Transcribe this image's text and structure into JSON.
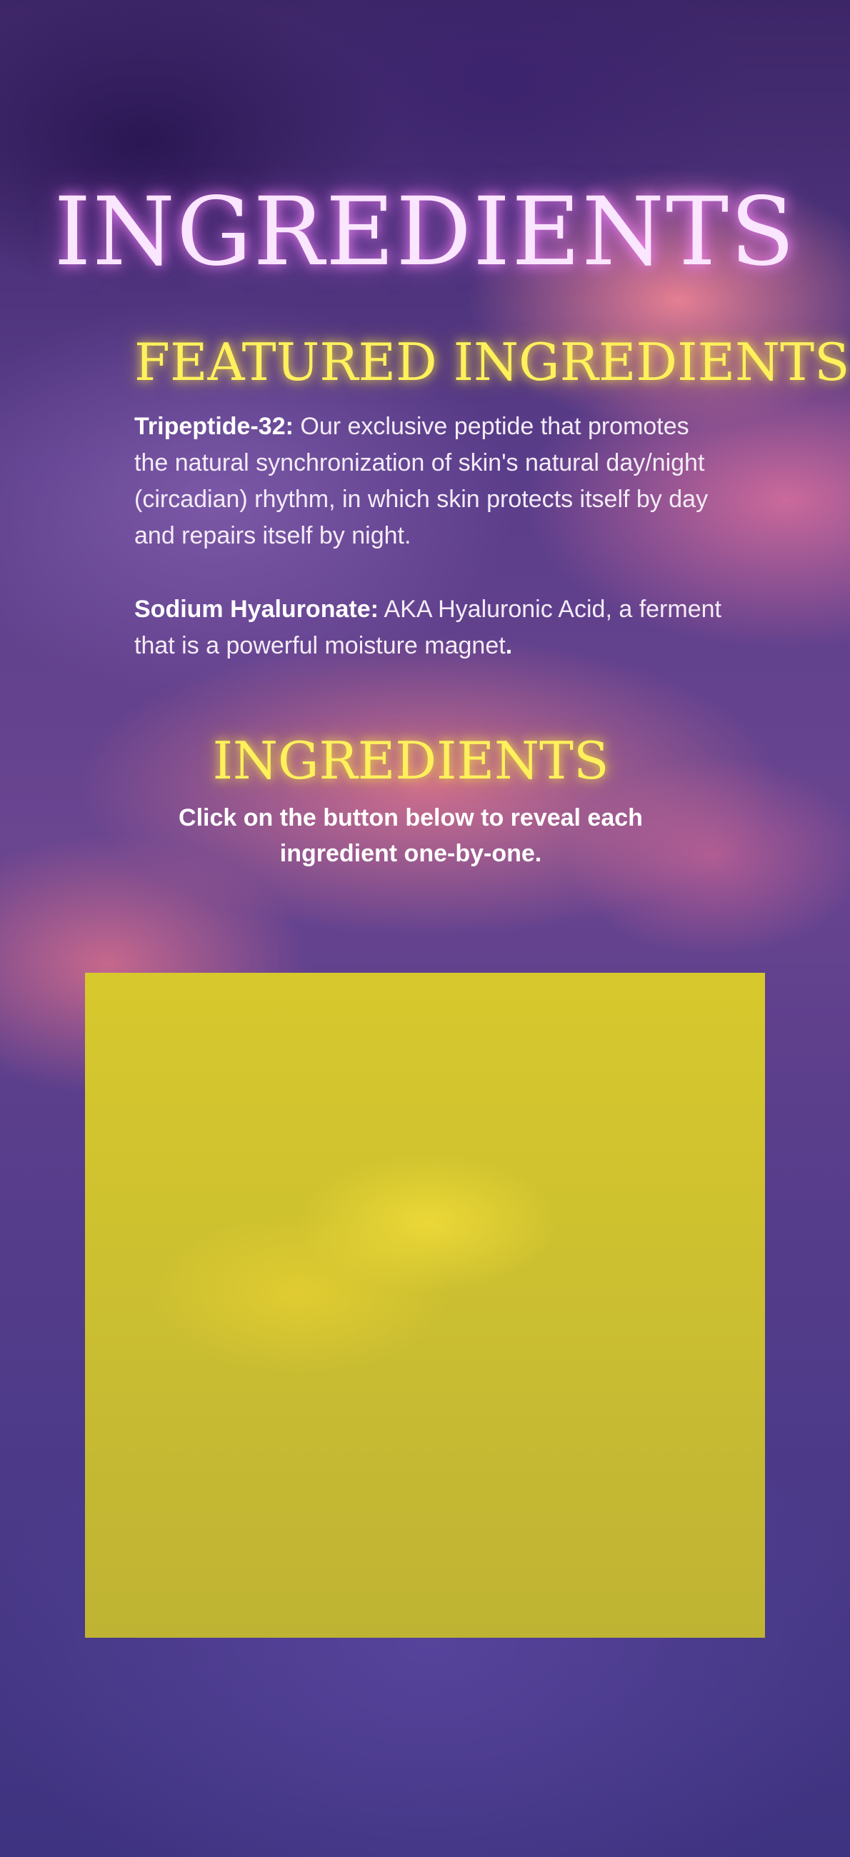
{
  "page": {
    "headline": "INGREDIENTS",
    "featured_heading": "FEATURED INGREDIENTS",
    "paragraphs": [
      {
        "term": "Tripeptide-32:",
        "text": " Our exclusive peptide that promotes the natural synchronization of skin's natural day/night (circadian) rhythm, in which skin protects itself by day and repairs itself by night."
      },
      {
        "term": "Sodium Hyaluronate:",
        "text": " AKA Hyaluronic Acid, a ferment that is a powerful moisture magnet",
        "end": "."
      }
    ],
    "ingredients_heading": "INGREDIENTS",
    "instruction": "Click on the button below to reveal each ingredient one-by-one."
  },
  "colors": {
    "headline_glow": "#fbe6ff",
    "heading_yellow": "#fff15c",
    "reveal_box": "#cfc22f"
  }
}
